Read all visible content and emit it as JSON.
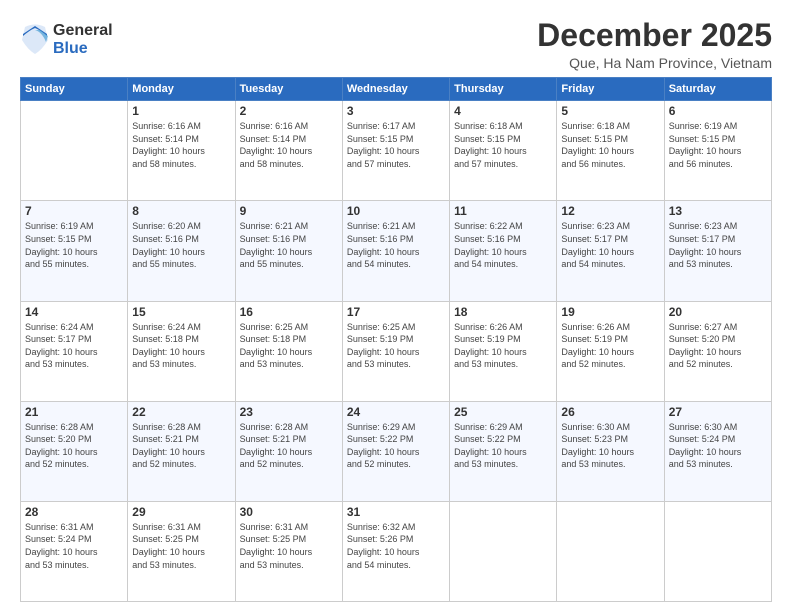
{
  "logo": {
    "general": "General",
    "blue": "Blue"
  },
  "header": {
    "month": "December 2025",
    "location": "Que, Ha Nam Province, Vietnam"
  },
  "weekdays": [
    "Sunday",
    "Monday",
    "Tuesday",
    "Wednesday",
    "Thursday",
    "Friday",
    "Saturday"
  ],
  "weeks": [
    [
      {
        "day": "",
        "info": ""
      },
      {
        "day": "1",
        "info": "Sunrise: 6:16 AM\nSunset: 5:14 PM\nDaylight: 10 hours\nand 58 minutes."
      },
      {
        "day": "2",
        "info": "Sunrise: 6:16 AM\nSunset: 5:14 PM\nDaylight: 10 hours\nand 58 minutes."
      },
      {
        "day": "3",
        "info": "Sunrise: 6:17 AM\nSunset: 5:15 PM\nDaylight: 10 hours\nand 57 minutes."
      },
      {
        "day": "4",
        "info": "Sunrise: 6:18 AM\nSunset: 5:15 PM\nDaylight: 10 hours\nand 57 minutes."
      },
      {
        "day": "5",
        "info": "Sunrise: 6:18 AM\nSunset: 5:15 PM\nDaylight: 10 hours\nand 56 minutes."
      },
      {
        "day": "6",
        "info": "Sunrise: 6:19 AM\nSunset: 5:15 PM\nDaylight: 10 hours\nand 56 minutes."
      }
    ],
    [
      {
        "day": "7",
        "info": "Sunrise: 6:19 AM\nSunset: 5:15 PM\nDaylight: 10 hours\nand 55 minutes."
      },
      {
        "day": "8",
        "info": "Sunrise: 6:20 AM\nSunset: 5:16 PM\nDaylight: 10 hours\nand 55 minutes."
      },
      {
        "day": "9",
        "info": "Sunrise: 6:21 AM\nSunset: 5:16 PM\nDaylight: 10 hours\nand 55 minutes."
      },
      {
        "day": "10",
        "info": "Sunrise: 6:21 AM\nSunset: 5:16 PM\nDaylight: 10 hours\nand 54 minutes."
      },
      {
        "day": "11",
        "info": "Sunrise: 6:22 AM\nSunset: 5:16 PM\nDaylight: 10 hours\nand 54 minutes."
      },
      {
        "day": "12",
        "info": "Sunrise: 6:23 AM\nSunset: 5:17 PM\nDaylight: 10 hours\nand 54 minutes."
      },
      {
        "day": "13",
        "info": "Sunrise: 6:23 AM\nSunset: 5:17 PM\nDaylight: 10 hours\nand 53 minutes."
      }
    ],
    [
      {
        "day": "14",
        "info": "Sunrise: 6:24 AM\nSunset: 5:17 PM\nDaylight: 10 hours\nand 53 minutes."
      },
      {
        "day": "15",
        "info": "Sunrise: 6:24 AM\nSunset: 5:18 PM\nDaylight: 10 hours\nand 53 minutes."
      },
      {
        "day": "16",
        "info": "Sunrise: 6:25 AM\nSunset: 5:18 PM\nDaylight: 10 hours\nand 53 minutes."
      },
      {
        "day": "17",
        "info": "Sunrise: 6:25 AM\nSunset: 5:19 PM\nDaylight: 10 hours\nand 53 minutes."
      },
      {
        "day": "18",
        "info": "Sunrise: 6:26 AM\nSunset: 5:19 PM\nDaylight: 10 hours\nand 53 minutes."
      },
      {
        "day": "19",
        "info": "Sunrise: 6:26 AM\nSunset: 5:19 PM\nDaylight: 10 hours\nand 52 minutes."
      },
      {
        "day": "20",
        "info": "Sunrise: 6:27 AM\nSunset: 5:20 PM\nDaylight: 10 hours\nand 52 minutes."
      }
    ],
    [
      {
        "day": "21",
        "info": "Sunrise: 6:28 AM\nSunset: 5:20 PM\nDaylight: 10 hours\nand 52 minutes."
      },
      {
        "day": "22",
        "info": "Sunrise: 6:28 AM\nSunset: 5:21 PM\nDaylight: 10 hours\nand 52 minutes."
      },
      {
        "day": "23",
        "info": "Sunrise: 6:28 AM\nSunset: 5:21 PM\nDaylight: 10 hours\nand 52 minutes."
      },
      {
        "day": "24",
        "info": "Sunrise: 6:29 AM\nSunset: 5:22 PM\nDaylight: 10 hours\nand 52 minutes."
      },
      {
        "day": "25",
        "info": "Sunrise: 6:29 AM\nSunset: 5:22 PM\nDaylight: 10 hours\nand 53 minutes."
      },
      {
        "day": "26",
        "info": "Sunrise: 6:30 AM\nSunset: 5:23 PM\nDaylight: 10 hours\nand 53 minutes."
      },
      {
        "day": "27",
        "info": "Sunrise: 6:30 AM\nSunset: 5:24 PM\nDaylight: 10 hours\nand 53 minutes."
      }
    ],
    [
      {
        "day": "28",
        "info": "Sunrise: 6:31 AM\nSunset: 5:24 PM\nDaylight: 10 hours\nand 53 minutes."
      },
      {
        "day": "29",
        "info": "Sunrise: 6:31 AM\nSunset: 5:25 PM\nDaylight: 10 hours\nand 53 minutes."
      },
      {
        "day": "30",
        "info": "Sunrise: 6:31 AM\nSunset: 5:25 PM\nDaylight: 10 hours\nand 53 minutes."
      },
      {
        "day": "31",
        "info": "Sunrise: 6:32 AM\nSunset: 5:26 PM\nDaylight: 10 hours\nand 54 minutes."
      },
      {
        "day": "",
        "info": ""
      },
      {
        "day": "",
        "info": ""
      },
      {
        "day": "",
        "info": ""
      }
    ]
  ]
}
